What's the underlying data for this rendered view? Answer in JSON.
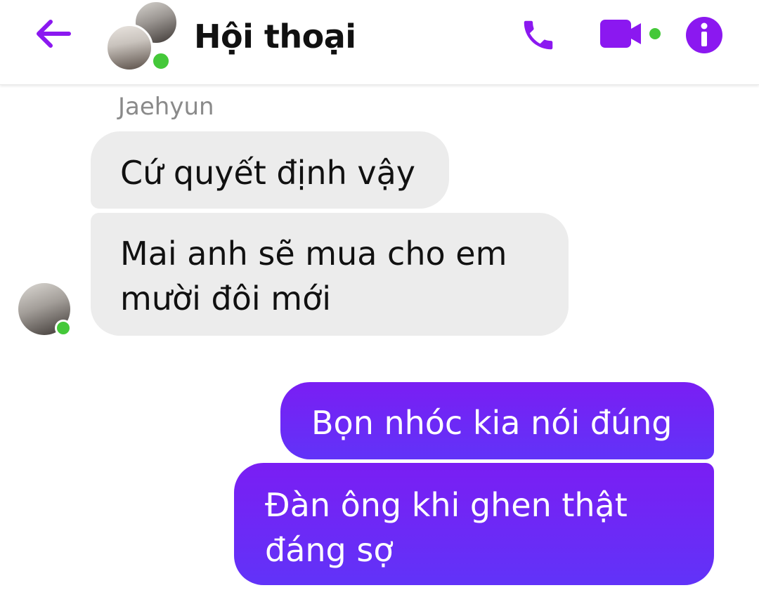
{
  "header": {
    "title": "Hội thoại",
    "back_icon": "arrow-left-icon",
    "call_icon": "phone-icon",
    "video_icon": "video-camera-icon",
    "info_icon": "info-icon"
  },
  "colors": {
    "accent": "#8b18f0",
    "online": "#44c839",
    "incoming_bubble": "#ececec",
    "outgoing_bubble_top": "#7a1ef3",
    "outgoing_bubble_bottom": "#6133f8"
  },
  "conversation": {
    "sender_name": "Jaehyun",
    "incoming": [
      {
        "text": "Cứ quyết định vậy"
      },
      {
        "text_line1": "Mai anh sẽ mua cho em",
        "text_line2": "mười đôi mới"
      }
    ],
    "outgoing": [
      {
        "text": "Bọn nhóc kia nói đúng"
      },
      {
        "text_line1": "Đàn ông khi ghen thật",
        "text_line2": "đáng sợ"
      }
    ]
  }
}
